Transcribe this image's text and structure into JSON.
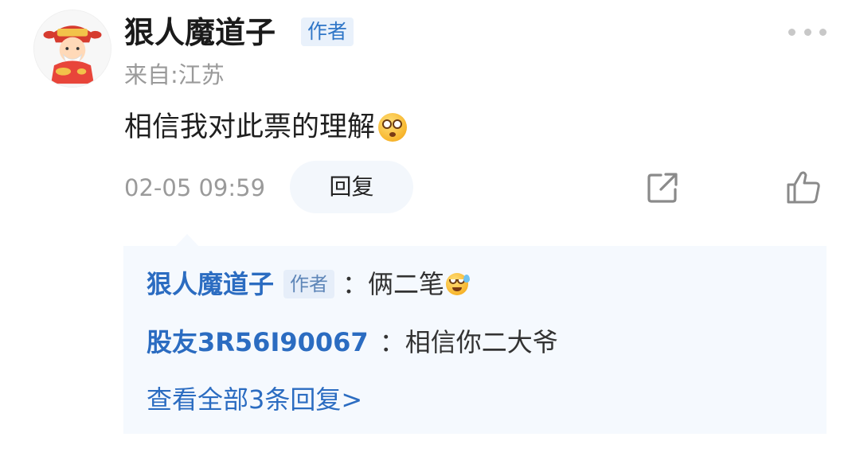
{
  "post": {
    "username": "狠人魔道子",
    "author_tag": "作者",
    "location": "来自:江苏",
    "content": "相信我对此票的理解",
    "timestamp": "02-05 09:59",
    "reply_label": "回复"
  },
  "icons": {
    "avatar": "caishen-avatar",
    "more": "more-dots-icon",
    "share": "share-icon",
    "like": "thumbs-up-icon",
    "emoji_content": "thinking-emoji",
    "emoji_reply": "sweat-smile-emoji"
  },
  "replies": [
    {
      "user": "狠人魔道子",
      "tag": "作者",
      "separator": "：",
      "text": "俩二笔"
    },
    {
      "user": "股友3R56I90067",
      "separator": "：",
      "text": "相信你二大爷"
    }
  ],
  "view_all": "查看全部3条回复>",
  "colors": {
    "accent": "#2b6cc1",
    "reply_bg": "#f5f9fe",
    "meta_text": "#9a9a9a"
  }
}
